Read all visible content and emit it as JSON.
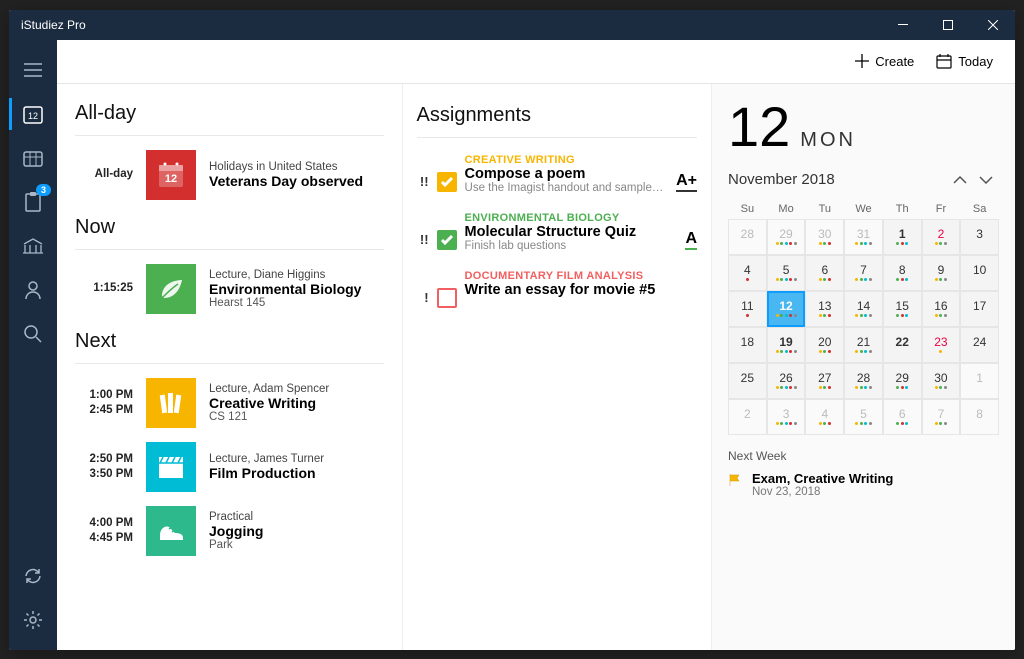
{
  "window": {
    "title": "iStudiez Pro"
  },
  "topbar": {
    "create": "Create",
    "today": "Today"
  },
  "sidebar": {
    "badge": "3"
  },
  "schedule": {
    "allday": {
      "title": "All-day",
      "label": "All-day",
      "items": [
        {
          "meta": "Holidays in United States",
          "name": "Veterans Day observed",
          "icon": "calendar",
          "color": "#d32f2f",
          "iconText": "12"
        }
      ]
    },
    "now": {
      "title": "Now",
      "items": [
        {
          "time": "1:15:25",
          "meta": "Lecture, Diane Higgins",
          "name": "Environmental Biology",
          "loc": "Hearst 145",
          "icon": "leaf",
          "color": "#4caf50"
        }
      ]
    },
    "next": {
      "title": "Next",
      "items": [
        {
          "time1": "1:00 PM",
          "time2": "2:45 PM",
          "meta": "Lecture, Adam Spencer",
          "name": "Creative Writing",
          "loc": "CS 121",
          "icon": "books",
          "color": "#f7b500"
        },
        {
          "time1": "2:50 PM",
          "time2": "3:50 PM",
          "meta": "Lecture, James Turner",
          "name": "Film Production",
          "loc": "",
          "icon": "film",
          "color": "#00bcd4"
        },
        {
          "time1": "4:00 PM",
          "time2": "4:45 PM",
          "meta": "Practical",
          "name": "Jogging",
          "loc": "Park",
          "icon": "shoe",
          "color": "#2db98c"
        }
      ]
    }
  },
  "assignments": {
    "title": "Assignments",
    "items": [
      {
        "priority": "!!",
        "checked": true,
        "color": "#f7b500",
        "course": "CREATIVE WRITING",
        "title": "Compose a poem",
        "note": "Use the Imagist handout and sample…",
        "grade": "A+",
        "gradeColor": "#333"
      },
      {
        "priority": "!!",
        "checked": true,
        "color": "#4caf50",
        "course": "ENVIRONMENTAL BIOLOGY",
        "title": "Molecular Structure Quiz",
        "note": "Finish lab questions",
        "grade": "A",
        "gradeColor": "#4caf50"
      },
      {
        "priority": "!",
        "checked": false,
        "color": "#f06060",
        "course": "DOCUMENTARY FILM ANALYSIS",
        "title": "Write an essay for movie #5",
        "note": "",
        "grade": ""
      }
    ]
  },
  "calendar": {
    "day": "12",
    "weekday": "MON",
    "month": "November 2018",
    "dow": [
      "Su",
      "Mo",
      "Tu",
      "We",
      "Th",
      "Fr",
      "Sa"
    ],
    "cells": [
      {
        "n": "28",
        "dim": true
      },
      {
        "n": "29",
        "dim": true,
        "dots": [
          "#f7b500",
          "#4caf50",
          "#00bcd4",
          "#d32f2f",
          "#888"
        ]
      },
      {
        "n": "30",
        "dim": true,
        "dots": [
          "#f7b500",
          "#4caf50",
          "#d32f2f"
        ]
      },
      {
        "n": "31",
        "dim": true,
        "dots": [
          "#f7b500",
          "#4caf50",
          "#00bcd4",
          "#888"
        ]
      },
      {
        "n": "1",
        "bold": true,
        "dots": [
          "#4caf50",
          "#d32f2f",
          "#00bcd4"
        ]
      },
      {
        "n": "2",
        "red": true,
        "dots": [
          "#f7b500",
          "#4caf50",
          "#888"
        ]
      },
      {
        "n": "3"
      },
      {
        "n": "4",
        "dots": [
          "#d32f2f"
        ]
      },
      {
        "n": "5",
        "dots": [
          "#f7b500",
          "#4caf50",
          "#00bcd4",
          "#d32f2f",
          "#888"
        ]
      },
      {
        "n": "6",
        "dots": [
          "#f7b500",
          "#4caf50",
          "#d32f2f"
        ]
      },
      {
        "n": "7",
        "dots": [
          "#f7b500",
          "#4caf50",
          "#00bcd4",
          "#888"
        ]
      },
      {
        "n": "8",
        "dots": [
          "#4caf50",
          "#d32f2f",
          "#00bcd4"
        ]
      },
      {
        "n": "9",
        "dots": [
          "#f7b500",
          "#4caf50",
          "#888"
        ]
      },
      {
        "n": "10"
      },
      {
        "n": "11",
        "dots": [
          "#d32f2f"
        ]
      },
      {
        "n": "12",
        "selected": true,
        "bold": true,
        "dots": [
          "#f7b500",
          "#4caf50",
          "#00bcd4",
          "#d32f2f",
          "#888"
        ]
      },
      {
        "n": "13",
        "dots": [
          "#f7b500",
          "#4caf50",
          "#d32f2f"
        ]
      },
      {
        "n": "14",
        "dots": [
          "#f7b500",
          "#4caf50",
          "#00bcd4",
          "#888"
        ]
      },
      {
        "n": "15",
        "dots": [
          "#4caf50",
          "#d32f2f",
          "#00bcd4"
        ]
      },
      {
        "n": "16",
        "dots": [
          "#f7b500",
          "#4caf50",
          "#888"
        ]
      },
      {
        "n": "17"
      },
      {
        "n": "18"
      },
      {
        "n": "19",
        "bold": true,
        "dots": [
          "#f7b500",
          "#4caf50",
          "#00bcd4",
          "#d32f2f",
          "#888"
        ]
      },
      {
        "n": "20",
        "dots": [
          "#f7b500",
          "#4caf50",
          "#d32f2f"
        ]
      },
      {
        "n": "21",
        "dots": [
          "#f7b500",
          "#4caf50",
          "#00bcd4",
          "#888"
        ]
      },
      {
        "n": "22",
        "bold": true
      },
      {
        "n": "23",
        "red": true,
        "dots": [
          "#f7b500"
        ]
      },
      {
        "n": "24"
      },
      {
        "n": "25"
      },
      {
        "n": "26",
        "dots": [
          "#f7b500",
          "#4caf50",
          "#00bcd4",
          "#d32f2f",
          "#888"
        ]
      },
      {
        "n": "27",
        "dots": [
          "#f7b500",
          "#4caf50",
          "#d32f2f"
        ]
      },
      {
        "n": "28",
        "dots": [
          "#f7b500",
          "#4caf50",
          "#00bcd4",
          "#888"
        ]
      },
      {
        "n": "29",
        "dots": [
          "#4caf50",
          "#d32f2f",
          "#00bcd4"
        ]
      },
      {
        "n": "30",
        "dots": [
          "#f7b500",
          "#4caf50",
          "#888"
        ]
      },
      {
        "n": "1",
        "dim": true
      },
      {
        "n": "2",
        "dim": true
      },
      {
        "n": "3",
        "dim": true,
        "dots": [
          "#f7b500",
          "#4caf50",
          "#00bcd4",
          "#d32f2f",
          "#888"
        ]
      },
      {
        "n": "4",
        "dim": true,
        "dots": [
          "#f7b500",
          "#4caf50",
          "#d32f2f"
        ]
      },
      {
        "n": "5",
        "dim": true,
        "dots": [
          "#f7b500",
          "#4caf50",
          "#00bcd4",
          "#888"
        ]
      },
      {
        "n": "6",
        "dim": true,
        "dots": [
          "#4caf50",
          "#d32f2f",
          "#00bcd4"
        ]
      },
      {
        "n": "7",
        "dim": true,
        "dots": [
          "#f7b500",
          "#4caf50",
          "#888"
        ]
      },
      {
        "n": "8",
        "dim": true
      }
    ],
    "nextweek": {
      "title": "Next Week",
      "name": "Exam, Creative Writing",
      "date": "Nov 23, 2018",
      "flagColor": "#f7b500"
    }
  }
}
